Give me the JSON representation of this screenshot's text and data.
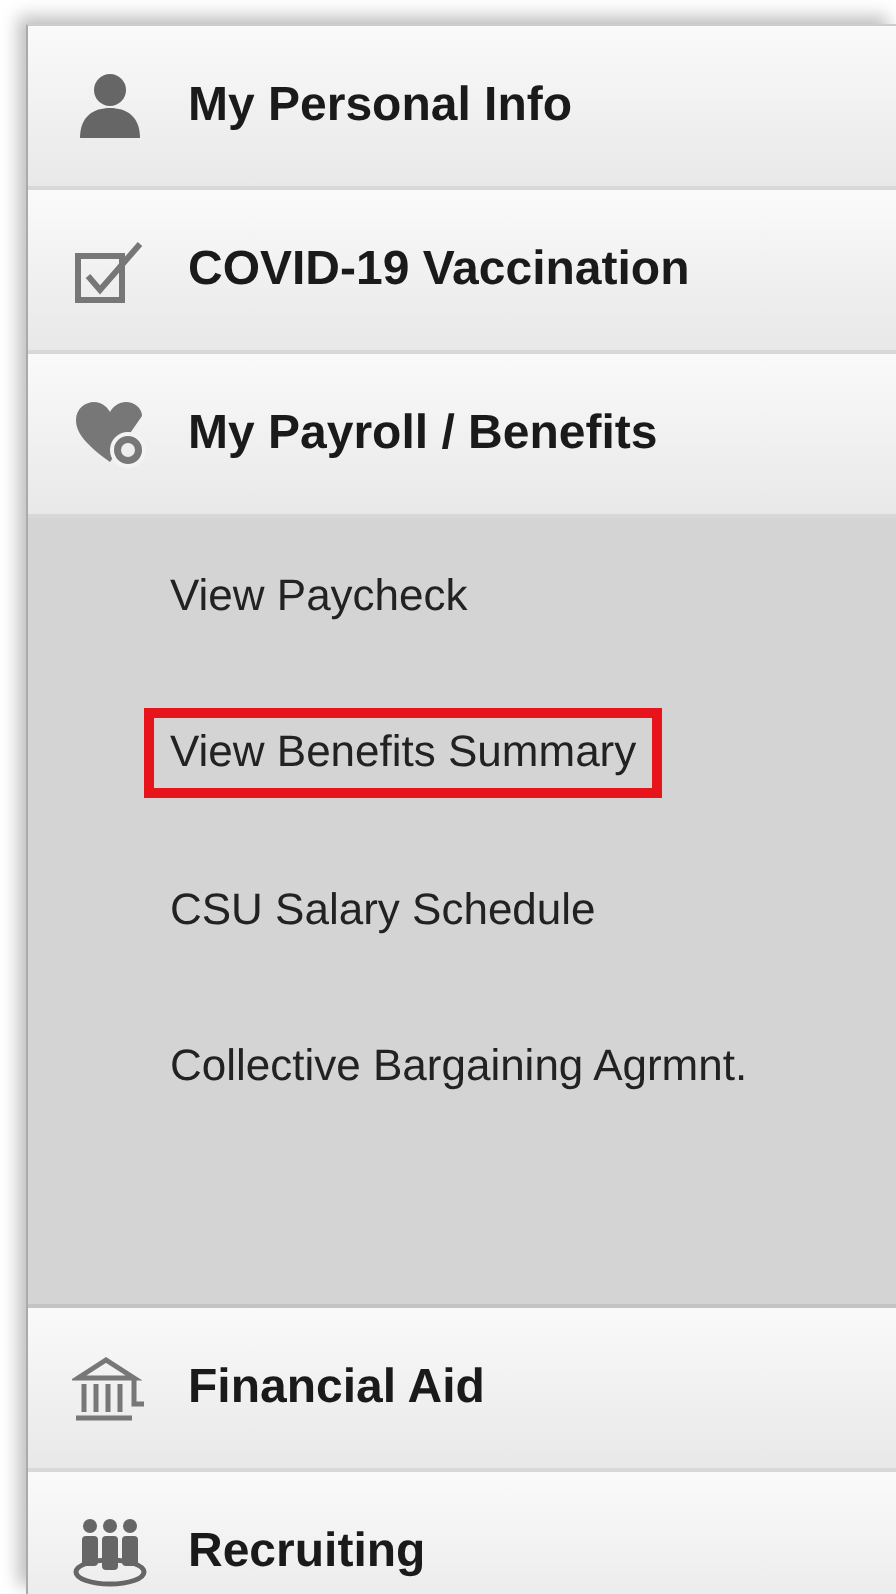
{
  "menu": [
    {
      "label": "My Personal Info"
    },
    {
      "label": "COVID-19 Vaccination"
    },
    {
      "label": "My Payroll / Benefits",
      "expanded": true,
      "children": [
        {
          "label": "View Paycheck",
          "highlighted": false
        },
        {
          "label": "View Benefits Summary",
          "highlighted": true
        },
        {
          "label": "CSU Salary Schedule",
          "highlighted": false
        },
        {
          "label": "Collective Bargaining Agrmnt.",
          "highlighted": false
        }
      ]
    },
    {
      "label": "Financial Aid"
    },
    {
      "label": "Recruiting"
    }
  ]
}
